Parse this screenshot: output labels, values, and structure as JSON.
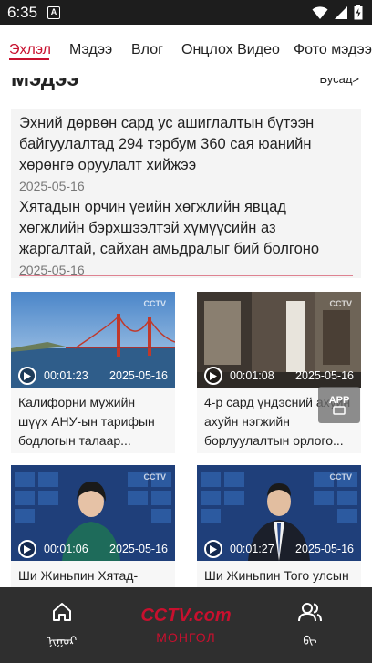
{
  "status_bar": {
    "time": "6:35",
    "notification_icon": "A",
    "icons": [
      "wifi-icon",
      "signal-icon",
      "battery-icon"
    ]
  },
  "tabs": [
    {
      "label": "Эхлэл",
      "active": true
    },
    {
      "label": "Мэдээ",
      "active": false
    },
    {
      "label": "Влог",
      "active": false
    },
    {
      "label": "Онцлох Видео",
      "active": false
    },
    {
      "label": "Фото мэдээ",
      "active": false
    }
  ],
  "section": {
    "title": "Мэдээ",
    "more_label": "Бусад>"
  },
  "news": [
    {
      "title": "Эхний дөрвөн сард ус ашиглалтын бүтээн байгуулалтад 294 тэрбум 360 сая юанийн хөрөнгө оруулалт хийжээ",
      "date": "2025-05-16"
    },
    {
      "title": "Хятадын орчин үеийн хөгжлийн явцад хөгжлийн бэрхшээлтэй хүмүүсийн аз жаргалтай, сайхан амьдралыг бий болгоно",
      "date": "2025-05-16"
    }
  ],
  "videos": [
    {
      "duration": "00:01:23",
      "date": "2025-05-16",
      "title": "Калифорни мужийн шүүх АНУ-ын тарифын бодлогын талаар..."
    },
    {
      "duration": "00:01:08",
      "date": "2025-05-16",
      "title": "4-р сард үндэсний ахуйн ахуйн нэгжийн борлуулалтын орлого..."
    },
    {
      "duration": "00:01:06",
      "date": "2025-05-16",
      "title": "Ши Жиньпин Хятад-"
    },
    {
      "duration": "00:01:27",
      "date": "2025-05-16",
      "title": "Ши Жиньпин Того улсын"
    }
  ],
  "thumb_badge": "CCTV",
  "app_float_label": "APP",
  "bottom_nav": {
    "home_label": "ᠨᠢᠭᠤᠷ",
    "center_logo": "CCTV.com",
    "center_label": "МОНГОЛ",
    "user_label": "ᠪᠢ"
  },
  "colors": {
    "accent": "#c8102e",
    "status_bar": "#1d1d1d",
    "bottom_nav": "#2f2f2f"
  }
}
